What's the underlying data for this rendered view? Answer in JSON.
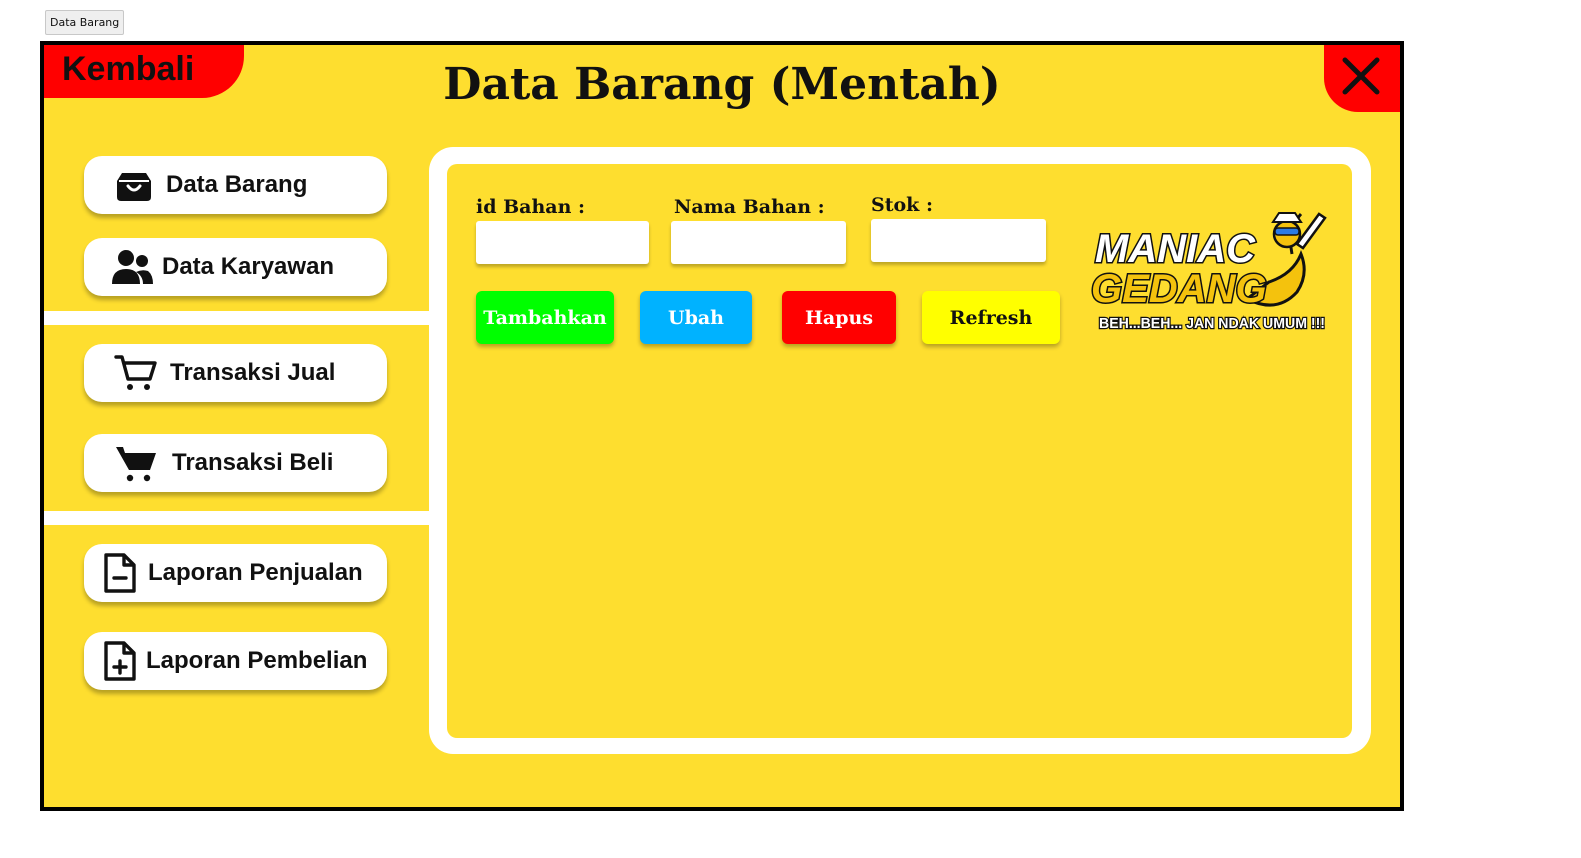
{
  "window": {
    "tab_label": "Data Barang"
  },
  "header": {
    "back_label": "Kembali",
    "title": "Data Barang (Mentah)",
    "close_icon": "close-icon"
  },
  "sidebar": {
    "items": [
      {
        "label": "Data Barang",
        "icon": "shopping-bag-icon"
      },
      {
        "label": "Data Karyawan",
        "icon": "users-icon"
      },
      {
        "label": "Transaksi Jual",
        "icon": "cart-outline-icon"
      },
      {
        "label": "Transaksi Beli",
        "icon": "cart-filled-icon"
      },
      {
        "label": "Laporan Penjualan",
        "icon": "document-minus-icon"
      },
      {
        "label": "Laporan Pembelian",
        "icon": "document-plus-icon"
      }
    ]
  },
  "form": {
    "id_label": "id Bahan :",
    "id_value": "",
    "name_label": "Nama  Bahan :",
    "name_value": "",
    "stock_label": "Stok :",
    "stock_value": ""
  },
  "actions": {
    "add": "Tambahkan",
    "edit": "Ubah",
    "delete": "Hapus",
    "refresh": "Refresh"
  },
  "logo": {
    "line1": "MANIAC",
    "line2": "GEDANG",
    "tagline": "BEH...BEH... JAN NDAK UMUM !!!"
  },
  "colors": {
    "background": "#FEDE2F",
    "accent_red": "#FF0000",
    "add_green": "#00FF00",
    "edit_blue": "#00B2FF",
    "delete_red": "#FF0000",
    "refresh_yellow": "#FFFF00"
  }
}
